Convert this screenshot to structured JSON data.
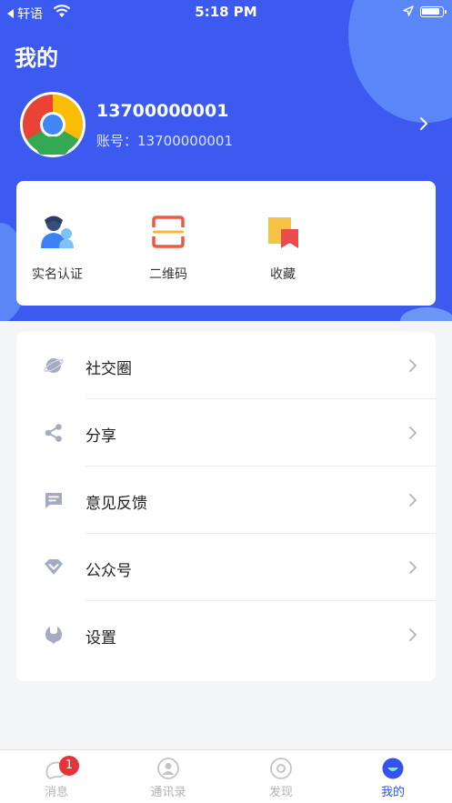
{
  "status_bar": {
    "back_app": "轩语",
    "time": "5:18 PM"
  },
  "page": {
    "title": "我的"
  },
  "profile": {
    "name": "13700000001",
    "account_label": "账号：",
    "account_value": "13700000001"
  },
  "quick_actions": [
    {
      "label": "实名认证",
      "icon": "verified-user-icon"
    },
    {
      "label": "二维码",
      "icon": "qr-scan-icon"
    },
    {
      "label": "收藏",
      "icon": "bookmark-icon"
    }
  ],
  "menu": [
    {
      "label": "社交圈",
      "icon": "planet-icon"
    },
    {
      "label": "分享",
      "icon": "share-icon"
    },
    {
      "label": "意见反馈",
      "icon": "feedback-icon"
    },
    {
      "label": "公众号",
      "icon": "diamond-icon"
    },
    {
      "label": "设置",
      "icon": "settings-icon"
    }
  ],
  "tab_bar": {
    "items": [
      {
        "label": "消息",
        "icon": "message-icon",
        "badge": "1"
      },
      {
        "label": "通讯录",
        "icon": "contacts-icon"
      },
      {
        "label": "发现",
        "icon": "discover-icon"
      },
      {
        "label": "我的",
        "icon": "me-icon",
        "active": true
      }
    ]
  },
  "colors": {
    "primary": "#3C5AF0",
    "badge": "#E8323A",
    "icon_gray": "#A5ACC0",
    "active_tab": "#3552EE"
  }
}
